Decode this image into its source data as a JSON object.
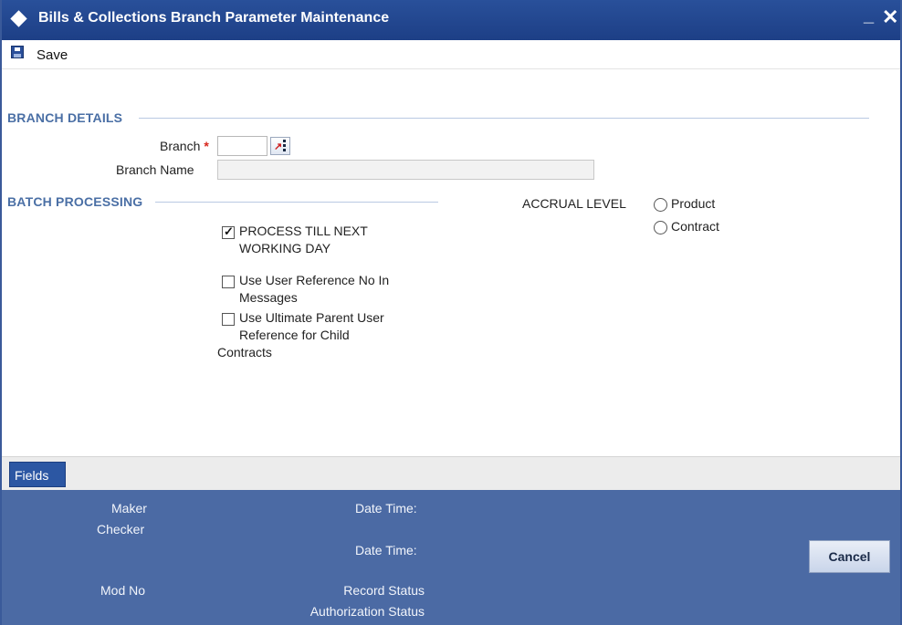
{
  "window": {
    "title": "Bills & Collections Branch Parameter Maintenance",
    "minimize": "_",
    "close": "✕"
  },
  "toolbar": {
    "save_label": "Save"
  },
  "branch_details": {
    "section_title": "BRANCH DETAILS",
    "branch_label": "Branch",
    "required_mark": "*",
    "branch_value": "",
    "branch_name_label": "Branch Name",
    "branch_name_value": ""
  },
  "batch_processing": {
    "section_title": "BATCH PROCESSING",
    "process_till_next_working_day": {
      "label_line1": "PROCESS TILL NEXT",
      "label_line2": "WORKING DAY",
      "checked": true
    },
    "use_user_reference": {
      "label_line1": "Use User Reference No In",
      "label_line2": "Messages",
      "checked": false
    },
    "use_ultimate_parent": {
      "label_line1": "Use Ultimate Parent User",
      "label_line2": "Reference for Child",
      "label_line3": "Contracts",
      "checked": false
    }
  },
  "accrual_level": {
    "label": "ACCRUAL LEVEL",
    "options": [
      "Product",
      "Contract"
    ],
    "selected": null
  },
  "footer": {
    "fields_tab": "Fields",
    "maker": "Maker",
    "checker": "Checker",
    "date_time_1": "Date Time:",
    "date_time_2": "Date Time:",
    "mod_no": "Mod No",
    "record_status": "Record Status",
    "authorization_status": "Authorization Status",
    "cancel": "Cancel"
  },
  "colors": {
    "titlebar": "#1d3f86",
    "section_title": "#4a6fa5",
    "audit_panel": "#4b6aa4",
    "required": "#d8261c"
  }
}
